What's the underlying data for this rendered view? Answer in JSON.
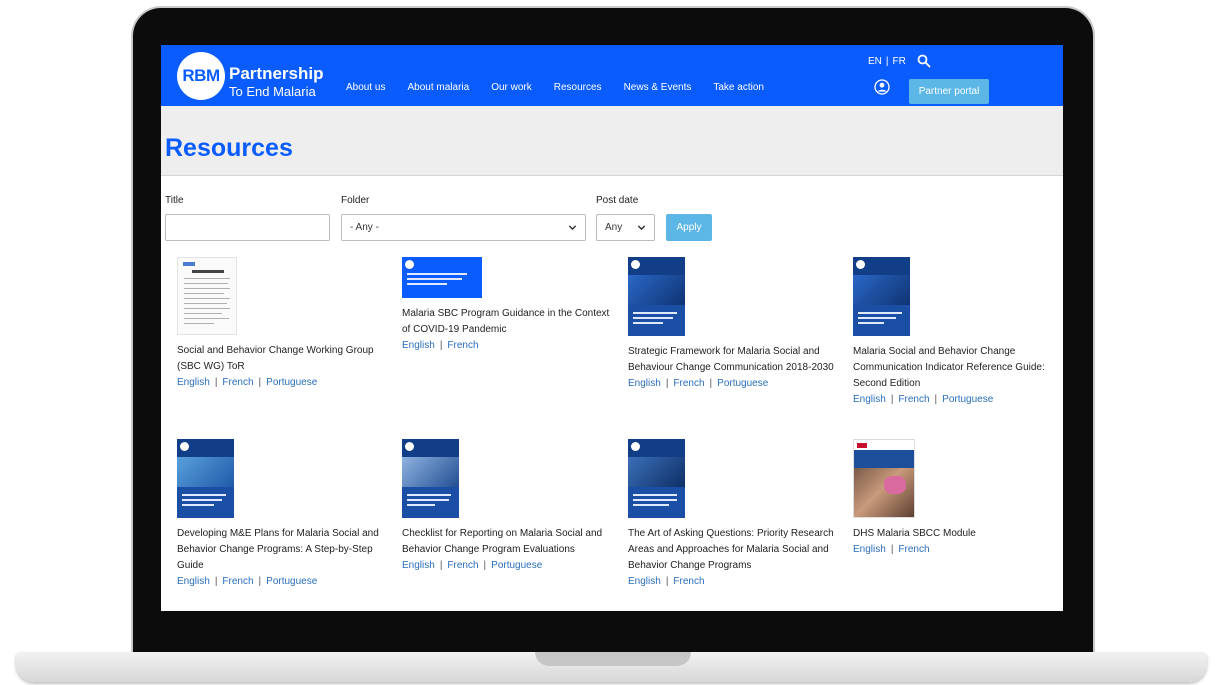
{
  "header": {
    "logo_mark": "RBM",
    "logo_line1": "Partnership",
    "logo_line2": "To End Malaria",
    "nav": [
      "About us",
      "About malaria",
      "Our work",
      "Resources",
      "News & Events",
      "Take action"
    ],
    "lang_en": "EN",
    "lang_sep": "|",
    "lang_fr": "FR",
    "partner_portal": "Partner portal"
  },
  "page_title": "Resources",
  "filters": {
    "title_label": "Title",
    "title_value": "",
    "folder_label": "Folder",
    "folder_value": "- Any -",
    "post_date_label": "Post date",
    "post_date_value": "Any",
    "apply_label": "Apply"
  },
  "link_sep": "|",
  "resources": [
    {
      "title": "Social and Behavior Change Working Group (SBC WG) ToR",
      "links": [
        "English",
        "French",
        "Portuguese"
      ]
    },
    {
      "title": "Malaria SBC Program Guidance in the Context of COVID-19 Pandemic",
      "links": [
        "English",
        "French"
      ]
    },
    {
      "title": "Strategic Framework for Malaria Social and Behaviour Change Communication 2018-2030",
      "links": [
        "English",
        "French",
        "Portuguese"
      ]
    },
    {
      "title": "Malaria Social and Behavior Change Communication Indicator Reference Guide: Second Edition",
      "links": [
        "English",
        "French",
        "Portuguese"
      ]
    },
    {
      "title": "Developing M&E Plans for Malaria Social and Behavior Change Programs: A Step-by-Step Guide",
      "links": [
        "English",
        "French",
        "Portuguese"
      ]
    },
    {
      "title": "Checklist for Reporting on Malaria Social and Behavior Change Program Evaluations",
      "links": [
        "English",
        "French",
        "Portuguese"
      ]
    },
    {
      "title": "The Art of Asking Questions: Priority Research Areas and Approaches for Malaria Social and Behavior Change Programs",
      "links": [
        "English",
        "French"
      ]
    },
    {
      "title": "DHS Malaria SBCC Module",
      "links": [
        "English",
        "French"
      ]
    }
  ],
  "colors": {
    "brand_blue": "#0a5cff",
    "button_light_blue": "#5cb7e6",
    "link_blue": "#2a6ebc"
  }
}
